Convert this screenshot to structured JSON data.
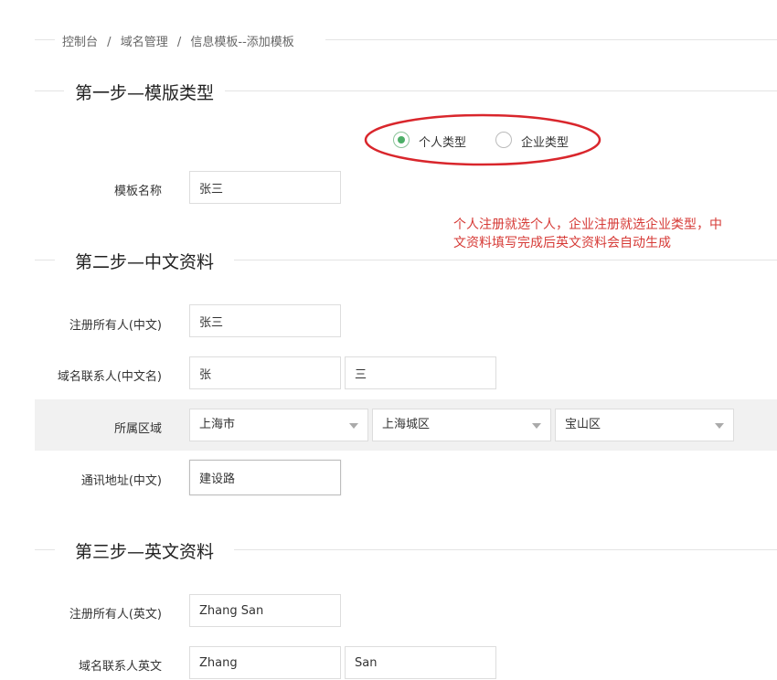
{
  "breadcrumb": {
    "items": [
      "控制台",
      "域名管理",
      "信息模板--添加模板"
    ],
    "separator": "/"
  },
  "step1": {
    "title": "第一步—模版类型",
    "radio_personal": "个人类型",
    "radio_company": "企业类型",
    "selected": "personal",
    "template_name_label": "模板名称",
    "template_name_value": "张三"
  },
  "note": {
    "line1": "个人注册就选个人，企业注册就选企业类型，中",
    "line2": "文资料填写完成后英文资料会自动生成",
    "color": "#d63a36"
  },
  "step2": {
    "title": "第二步—中文资料",
    "owner_label": "注册所有人(中文)",
    "owner_value": "张三",
    "contact_label": "域名联系人(中文名)",
    "contact_surname": "张",
    "contact_given": "三",
    "region_label": "所属区域",
    "region_province": "上海市",
    "region_city": "上海城区",
    "region_district": "宝山区",
    "address_label": "通讯地址(中文)",
    "address_value": "建设路"
  },
  "step3": {
    "title": "第三步—英文资料",
    "owner_label": "注册所有人(英文)",
    "owner_value": "Zhang San",
    "contact_label": "域名联系人英文",
    "contact_surname": "Zhang",
    "contact_given": "San"
  },
  "colors": {
    "radio_selected": "#4cae67",
    "annotation_ellipse": "#d9262c",
    "region_band": "#f1f1f1"
  }
}
